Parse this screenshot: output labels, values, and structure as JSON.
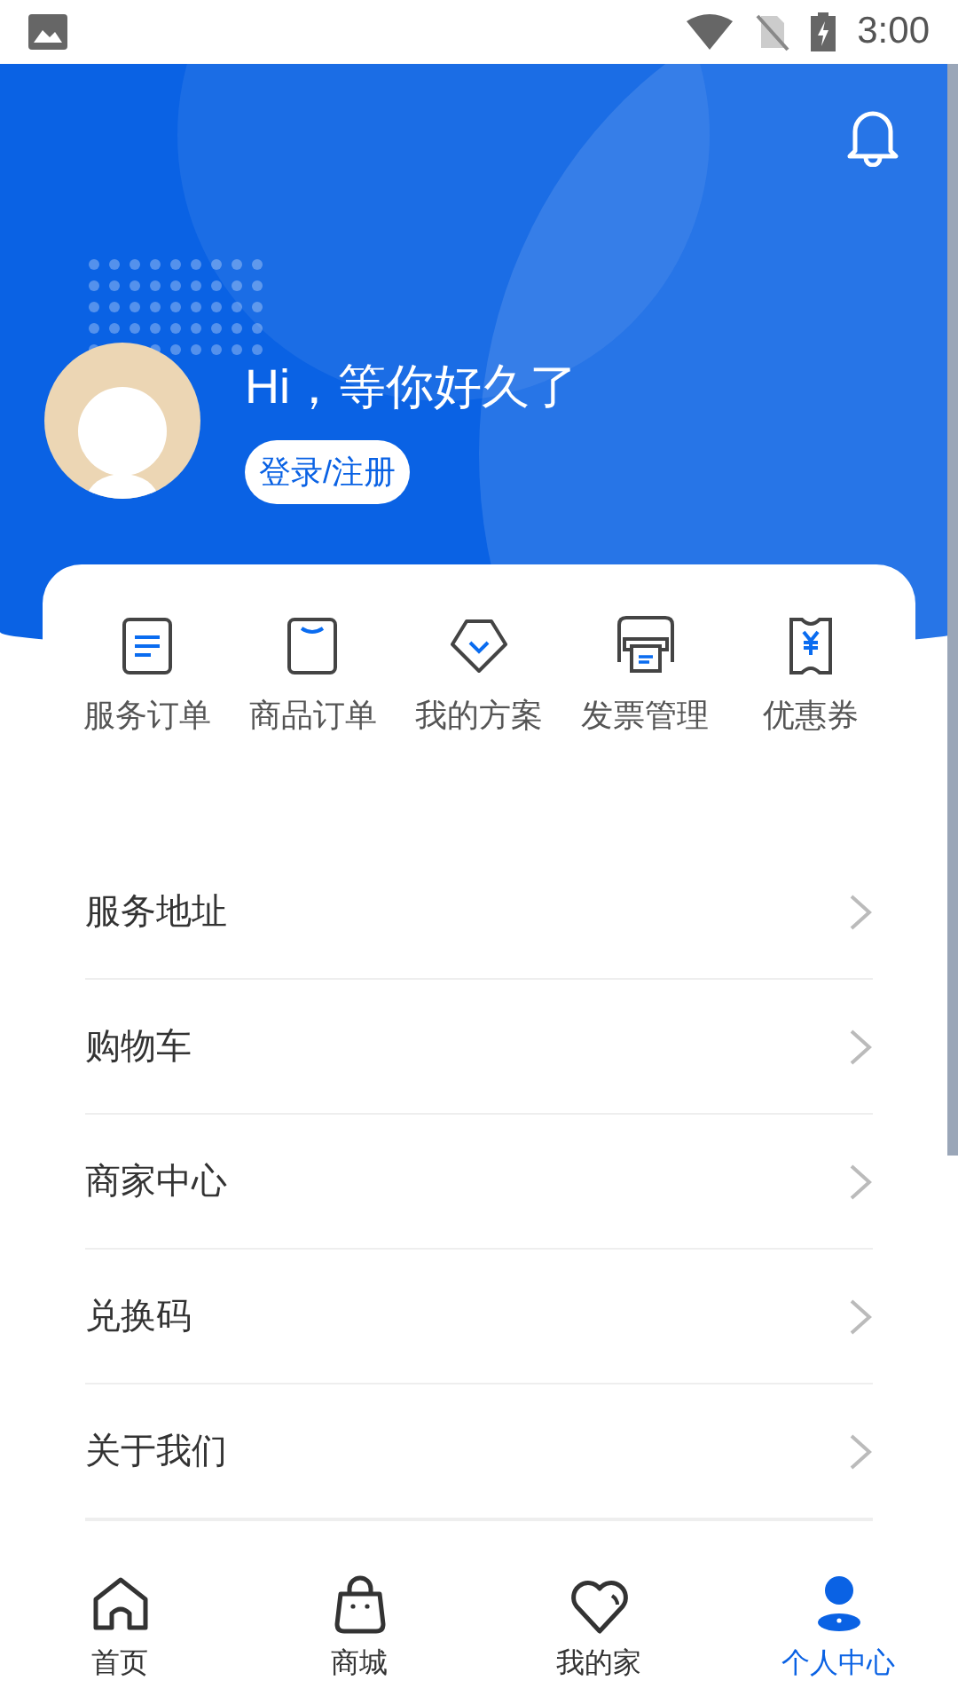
{
  "status_bar": {
    "time": "3:00"
  },
  "header": {
    "greeting": "Hi，等你好久了",
    "login_button": "登录/注册"
  },
  "quick_actions": [
    {
      "kind": "doc",
      "label": "服务订单"
    },
    {
      "kind": "bag",
      "label": "商品订单"
    },
    {
      "kind": "diamond",
      "label": "我的方案"
    },
    {
      "kind": "printer",
      "label": "发票管理"
    },
    {
      "kind": "ticket",
      "label": "优惠券"
    }
  ],
  "menu": [
    {
      "label": "服务地址"
    },
    {
      "label": "购物车"
    },
    {
      "label": "商家中心"
    },
    {
      "label": "兑换码"
    },
    {
      "label": "关于我们"
    }
  ],
  "bottom_nav": [
    {
      "kind": "home",
      "label": "首页",
      "selected": false
    },
    {
      "kind": "shop",
      "label": "商城",
      "selected": false
    },
    {
      "kind": "heart",
      "label": "我的家",
      "selected": false
    },
    {
      "kind": "person",
      "label": "个人中心",
      "selected": true
    }
  ]
}
